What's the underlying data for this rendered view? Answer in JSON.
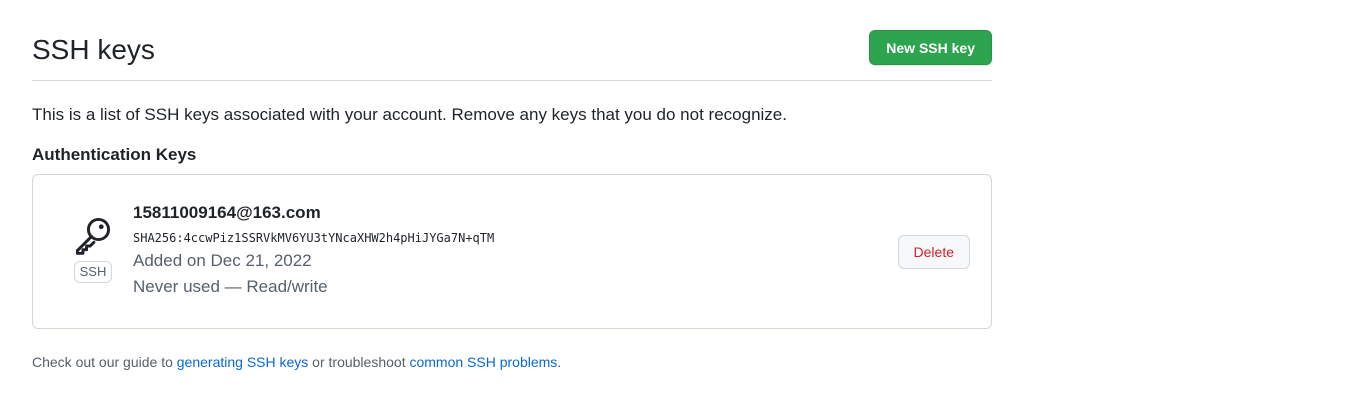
{
  "header": {
    "title": "SSH keys",
    "new_key_button": "New SSH key"
  },
  "description": "This is a list of SSH keys associated with your account. Remove any keys that you do not recognize.",
  "section_title": "Authentication Keys",
  "key": {
    "icon": "key-icon",
    "badge": "SSH",
    "title": "15811009164@163.com",
    "fingerprint": "SHA256:4ccwPiz1SSRVkMV6YU3tYNcaXHW2h4pHiJYGa7N+qTM",
    "added": "Added on Dec 21, 2022",
    "usage": "Never used — Read/write",
    "delete_button": "Delete"
  },
  "footer": {
    "prefix": "Check out our guide to ",
    "link1": "generating SSH keys",
    "middle": " or troubleshoot ",
    "link2": "common SSH problems",
    "suffix": "."
  },
  "colors": {
    "primary_button": "#2da44e",
    "danger_text": "#cf222e",
    "link": "#0969da",
    "border": "#d0d7de"
  }
}
